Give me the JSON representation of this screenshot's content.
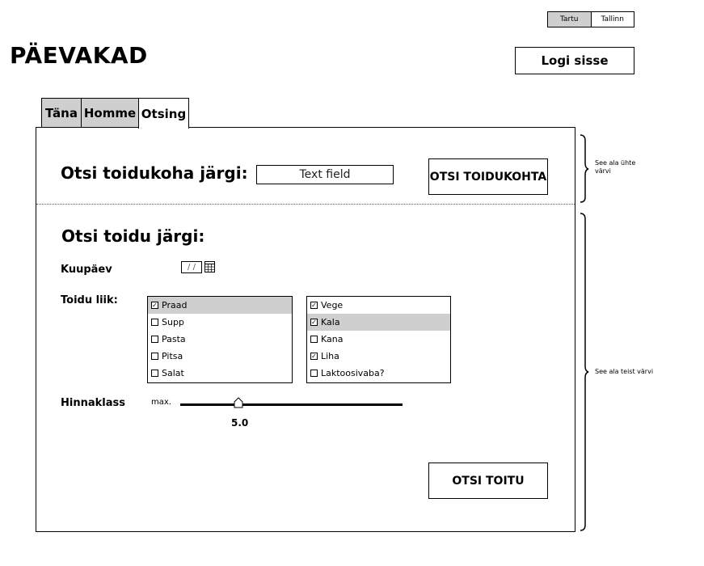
{
  "city_toggle": {
    "options": [
      {
        "label": "Tartu",
        "active": true
      },
      {
        "label": "Tallinn",
        "active": false
      }
    ]
  },
  "header": {
    "title": "PÄEVAKAD",
    "login_label": "Logi sisse"
  },
  "tabs": [
    {
      "label": "Täna",
      "active": false
    },
    {
      "label": "Homme",
      "active": false
    },
    {
      "label": "Otsing",
      "active": true
    }
  ],
  "place_search": {
    "heading": "Otsi toidukoha järgi:",
    "input_value": "Text field",
    "button_label": "OTSI TOIDUKOHTA"
  },
  "food_search": {
    "heading": "Otsi toidu järgi:",
    "date_label": "Kuupäev",
    "date_value": "/ /",
    "type_label": "Toidu liik:",
    "list1": [
      {
        "label": "Praad",
        "checked": true,
        "selected": true
      },
      {
        "label": "Supp",
        "checked": false,
        "selected": false
      },
      {
        "label": "Pasta",
        "checked": false,
        "selected": false
      },
      {
        "label": "Pitsa",
        "checked": false,
        "selected": false
      },
      {
        "label": "Salat",
        "checked": false,
        "selected": false
      }
    ],
    "list2": [
      {
        "label": "Vege",
        "checked": true,
        "selected": false
      },
      {
        "label": "Kala",
        "checked": true,
        "selected": true
      },
      {
        "label": "Kana",
        "checked": false,
        "selected": false
      },
      {
        "label": "Liha",
        "checked": true,
        "selected": false
      },
      {
        "label": "Laktoosivaba?",
        "checked": false,
        "selected": false
      }
    ],
    "price_label": "Hinnaklass",
    "price_prefix": "max.",
    "price_value": "5.0",
    "button_label": "OTSI TOITU"
  },
  "annotations": {
    "top": "See ala ühte värvi",
    "bottom": "See ala teist värvi"
  },
  "colors": {
    "selected_gray": "#cfcfcf",
    "border": "#000000"
  }
}
